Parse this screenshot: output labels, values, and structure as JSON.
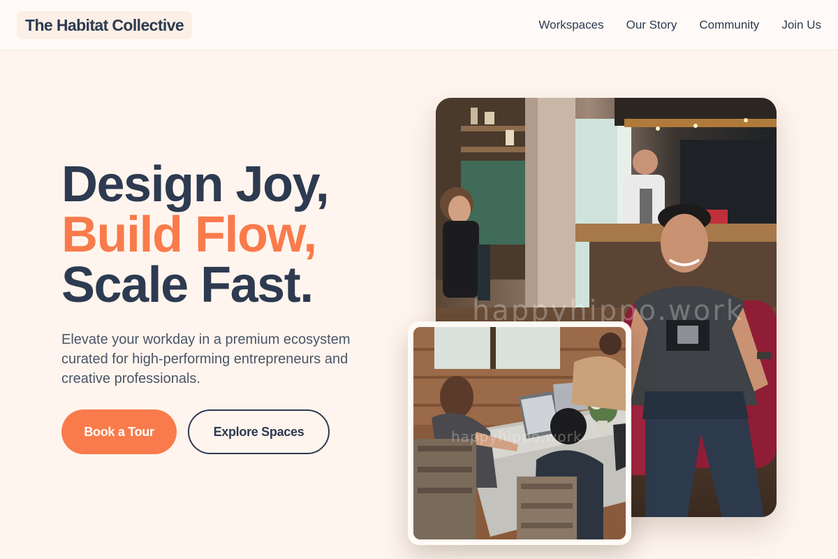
{
  "header": {
    "logo": "The Habitat Collective",
    "nav": [
      {
        "label": "Workspaces"
      },
      {
        "label": "Our Story"
      },
      {
        "label": "Community"
      },
      {
        "label": "Join Us"
      }
    ]
  },
  "hero": {
    "headline_line1": "Design Joy,",
    "headline_line2": "Build Flow,",
    "headline_line3": "Scale Fast.",
    "subtitle": "Elevate your workday in a premium ecosystem curated for high-performing entrepreneurs and creative professionals.",
    "primary_cta": "Book a Tour",
    "secondary_cta": "Explore Spaces"
  },
  "images": {
    "watermark": "happyhippo.work"
  },
  "colors": {
    "background": "#fff5ee",
    "text": "#2d3a50",
    "accent": "#f97b4b"
  }
}
